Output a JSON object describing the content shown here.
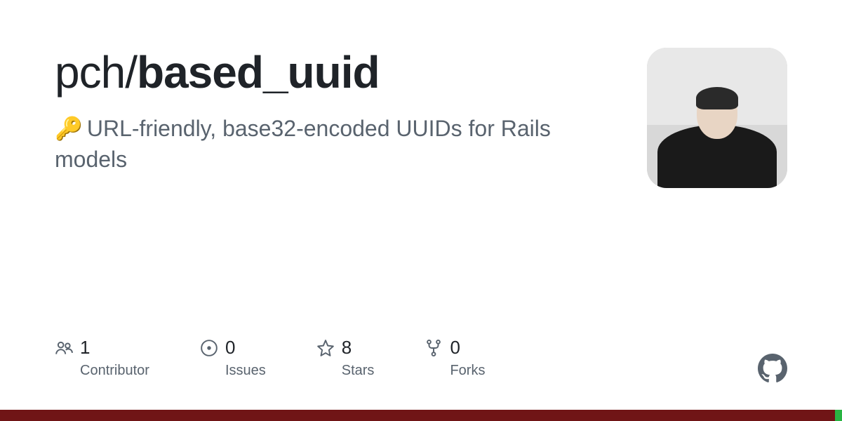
{
  "repo": {
    "owner": "pch",
    "separator": "/",
    "name": "based_uuid"
  },
  "description": {
    "emoji": "🔑",
    "text": "URL-friendly, base32-encoded UUIDs for Rails models"
  },
  "stats": {
    "contributors": {
      "value": "1",
      "label": "Contributor"
    },
    "issues": {
      "value": "0",
      "label": "Issues"
    },
    "stars": {
      "value": "8",
      "label": "Stars"
    },
    "forks": {
      "value": "0",
      "label": "Forks"
    }
  },
  "language_bar": [
    {
      "color": "#701516",
      "width": "99.2%"
    },
    {
      "color": "#29b442",
      "width": "0.8%"
    }
  ]
}
